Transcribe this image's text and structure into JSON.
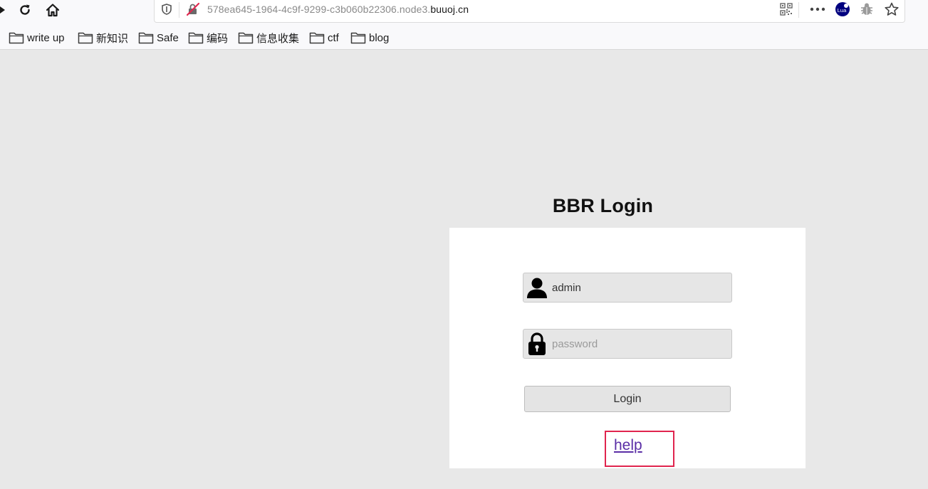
{
  "browser": {
    "url_prefix": "578ea645-1964-4c9f-9299-c3b060b22306.node3.",
    "url_domain": "buuoj.cn",
    "extension_badge": "Lua"
  },
  "bookmarks": [
    {
      "label": "write up"
    },
    {
      "label": "新知识"
    },
    {
      "label": "Safe"
    },
    {
      "label": "编码"
    },
    {
      "label": "信息收集"
    },
    {
      "label": "ctf"
    },
    {
      "label": "blog"
    }
  ],
  "page": {
    "title": "BBR Login",
    "username_value": "admin",
    "password_placeholder": "password",
    "login_label": "Login",
    "help_label": "help"
  },
  "colors": {
    "highlight_box": "#e0244e",
    "link": "#5a2ea6",
    "page_bg": "#e8e8e8"
  }
}
